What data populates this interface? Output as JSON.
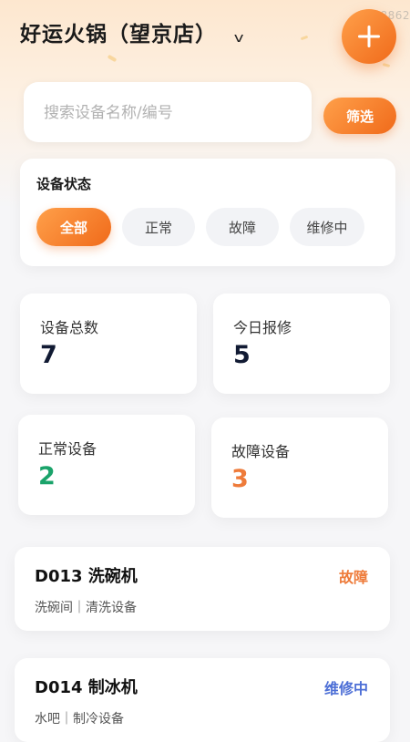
{
  "header": {
    "store_name": "好运火锅（望京店）",
    "chevron": "v",
    "id_badge": "ID:8862",
    "add_icon": "plus-icon",
    "accent": "#f37a26"
  },
  "search": {
    "placeholder": "搜索设备名称/编号",
    "value": "",
    "filter_label": "筛选"
  },
  "status_filter": {
    "title": "设备状态",
    "options": [
      "全部",
      "正常",
      "故障",
      "维修中"
    ],
    "selected": "全部"
  },
  "stats": [
    {
      "label": "设备总数",
      "value": "7"
    },
    {
      "label": "今日报修",
      "value": "5"
    },
    {
      "label": "正常设备",
      "value": "2",
      "color": "#1aa36a"
    },
    {
      "label": "故障设备",
      "value": "3",
      "color": "#ee7b3a"
    }
  ],
  "devices": [
    {
      "name": "D013 洗碗机",
      "meta": "洗碗间｜清洗设备",
      "status": "故障",
      "status_color": "#ee7b3a"
    },
    {
      "name": "D014 制冰机",
      "meta": "水吧｜制冷设备",
      "status": "维修中",
      "status_color": "#4d6fd6"
    }
  ]
}
